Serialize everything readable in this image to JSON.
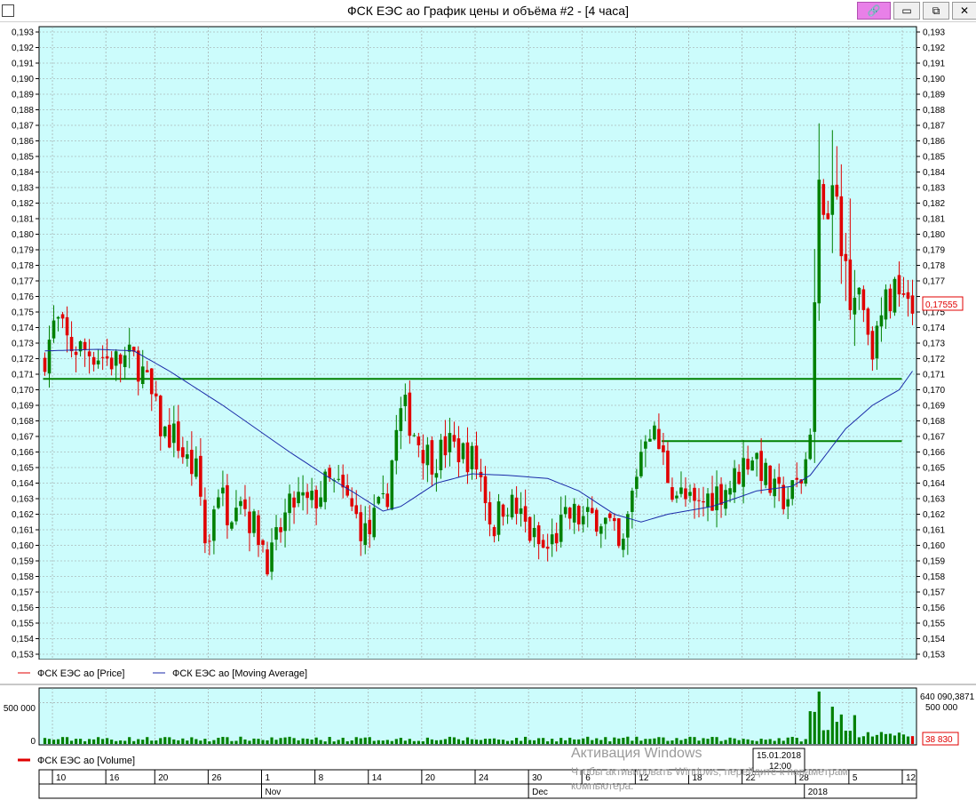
{
  "window": {
    "title": "ФСК ЕЭС ао График цены и объёма #2 - [4 часа]",
    "minimize_glyph": "▭",
    "restore_glyph": "⧉",
    "close_glyph": "✕",
    "link_icon": "link-icon"
  },
  "chart_data": {
    "type": "candlestick",
    "price_panel": {
      "ylim": [
        0.153,
        0.193
      ],
      "yticks": [
        "0,193",
        "0,192",
        "0,191",
        "0,190",
        "0,189",
        "0,188",
        "0,187",
        "0,186",
        "0,185",
        "0,184",
        "0,183",
        "0,182",
        "0,181",
        "0,180",
        "0,179",
        "0,178",
        "0,177",
        "0,176",
        "0,175",
        "0,174",
        "0,173",
        "0,172",
        "0,171",
        "0,170",
        "0,169",
        "0,168",
        "0,167",
        "0,166",
        "0,165",
        "0,164",
        "0,163",
        "0,162",
        "0,161",
        "0,160",
        "0,159",
        "0,158",
        "0,157",
        "0,156",
        "0,155",
        "0,154",
        "0,153"
      ],
      "last_price_label": "0,17555",
      "last_price": 0.17555,
      "up_color": "#008000",
      "down_color": "#e00000",
      "ma_color": "#1a2aa8",
      "line_color": "#008000",
      "background": "#ccfcfc",
      "horizontal_lines": [
        {
          "value": 0.1707,
          "from_bar": 0,
          "to_bar": 191
        },
        {
          "value": 0.1667,
          "from_bar": 139,
          "to_bar": 191
        }
      ],
      "legend": [
        {
          "label": "ФСК ЕЭС ао [Price]",
          "color": "#e00000"
        },
        {
          "label": "ФСК ЕЭС ао [Moving Average]",
          "color": "#1a2aa8"
        }
      ],
      "ohlc_anchors": [
        [
          0,
          0.1718
        ],
        [
          3,
          0.1745
        ],
        [
          6,
          0.1728
        ],
        [
          10,
          0.1725
        ],
        [
          13,
          0.1722
        ],
        [
          16,
          0.1718
        ],
        [
          20,
          0.172
        ],
        [
          22,
          0.1715
        ],
        [
          25,
          0.169
        ],
        [
          27,
          0.1672
        ],
        [
          30,
          0.167
        ],
        [
          32,
          0.1655
        ],
        [
          35,
          0.1645
        ],
        [
          36,
          0.1615
        ],
        [
          37,
          0.159
        ],
        [
          39,
          0.164
        ],
        [
          42,
          0.162
        ],
        [
          44,
          0.164
        ],
        [
          46,
          0.162
        ],
        [
          49,
          0.1605
        ],
        [
          51,
          0.1588
        ],
        [
          54,
          0.1615
        ],
        [
          57,
          0.163
        ],
        [
          60,
          0.1625
        ],
        [
          64,
          0.164
        ],
        [
          67,
          0.1635
        ],
        [
          70,
          0.162
        ],
        [
          73,
          0.1605
        ],
        [
          75,
          0.162
        ],
        [
          77,
          0.1625
        ],
        [
          79,
          0.1665
        ],
        [
          81,
          0.169
        ],
        [
          84,
          0.167
        ],
        [
          86,
          0.166
        ],
        [
          88,
          0.1655
        ],
        [
          91,
          0.1665
        ],
        [
          94,
          0.166
        ],
        [
          97,
          0.1655
        ],
        [
          99,
          0.164
        ],
        [
          101,
          0.161
        ],
        [
          104,
          0.163
        ],
        [
          107,
          0.162
        ],
        [
          110,
          0.1605
        ],
        [
          113,
          0.1595
        ],
        [
          116,
          0.161
        ],
        [
          119,
          0.162
        ],
        [
          122,
          0.1615
        ],
        [
          125,
          0.162
        ],
        [
          128,
          0.161
        ],
        [
          130,
          0.159
        ],
        [
          132,
          0.1625
        ],
        [
          134,
          0.1655
        ],
        [
          136,
          0.168
        ],
        [
          139,
          0.166
        ],
        [
          141,
          0.164
        ],
        [
          144,
          0.163
        ],
        [
          147,
          0.1622
        ],
        [
          149,
          0.163
        ],
        [
          152,
          0.1635
        ],
        [
          155,
          0.164
        ],
        [
          158,
          0.1655
        ],
        [
          160,
          0.166
        ],
        [
          163,
          0.164
        ],
        [
          165,
          0.163
        ],
        [
          168,
          0.1632
        ],
        [
          171,
          0.1645
        ],
        [
          172,
          0.1665
        ],
        [
          173,
          0.1715
        ],
        [
          174,
          0.179
        ],
        [
          175,
          0.184
        ],
        [
          176,
          0.18
        ],
        [
          177,
          0.181
        ],
        [
          178,
          0.183
        ],
        [
          179,
          0.179
        ],
        [
          181,
          0.178
        ],
        [
          183,
          0.1775
        ],
        [
          185,
          0.1745
        ],
        [
          187,
          0.1725
        ],
        [
          189,
          0.1755
        ],
        [
          191,
          0.176
        ],
        [
          193,
          0.1775
        ],
        [
          195,
          0.1757
        ]
      ],
      "moving_average_anchors": [
        [
          0,
          0.1725
        ],
        [
          12,
          0.1726
        ],
        [
          20,
          0.1725
        ],
        [
          28,
          0.1712
        ],
        [
          40,
          0.169
        ],
        [
          55,
          0.166
        ],
        [
          63,
          0.1645
        ],
        [
          70,
          0.1633
        ],
        [
          76,
          0.1622
        ],
        [
          80,
          0.1625
        ],
        [
          88,
          0.164
        ],
        [
          96,
          0.1646
        ],
        [
          104,
          0.1645
        ],
        [
          113,
          0.1643
        ],
        [
          120,
          0.1635
        ],
        [
          128,
          0.162
        ],
        [
          134,
          0.1615
        ],
        [
          140,
          0.162
        ],
        [
          150,
          0.1625
        ],
        [
          160,
          0.1635
        ],
        [
          168,
          0.1638
        ],
        [
          172,
          0.1645
        ],
        [
          176,
          0.166
        ],
        [
          180,
          0.1675
        ],
        [
          186,
          0.169
        ],
        [
          192,
          0.17
        ],
        [
          195,
          0.1712
        ]
      ]
    },
    "volume_panel": {
      "ytick": "500 000",
      "ytick_value": 500000,
      "ytick_zero": "0",
      "right_top_label": "640 090,3871",
      "right_mid_label": "500 000",
      "last_volume_label": "38 830",
      "last_volume": 38830,
      "ymax": 640090,
      "bar_color": "#008000",
      "down_bar_color": "#e00000",
      "legend": {
        "label": "ФСК ЕЭС ао [Volume]",
        "color": "#e00000"
      }
    },
    "x_axis": {
      "bars": 196,
      "day_ticks": [
        {
          "label": "10",
          "bar": 3
        },
        {
          "label": "16",
          "bar": 15
        },
        {
          "label": "20",
          "bar": 26
        },
        {
          "label": "26",
          "bar": 38
        },
        {
          "label": "1",
          "bar": 50
        },
        {
          "label": "8",
          "bar": 62
        },
        {
          "label": "14",
          "bar": 74
        },
        {
          "label": "20",
          "bar": 86
        },
        {
          "label": "24",
          "bar": 98
        },
        {
          "label": "30",
          "bar": 110
        },
        {
          "label": "6",
          "bar": 122
        },
        {
          "label": "12",
          "bar": 134
        },
        {
          "label": "18",
          "bar": 146
        },
        {
          "label": "22",
          "bar": 158
        },
        {
          "label": "28",
          "bar": 170
        },
        {
          "label": "5",
          "bar": 182
        },
        {
          "label": "12",
          "bar": 194
        }
      ],
      "month_ticks": [
        {
          "label": "Nov",
          "bar": 50
        },
        {
          "label": "Dec",
          "bar": 110
        },
        {
          "label": "2018",
          "bar": 172
        }
      ],
      "cursor_label_date": "15.01.2018",
      "cursor_label_time": "12:00"
    }
  },
  "watermark": {
    "line1": "Активация Windows",
    "line2": "Чтобы активировать Windows, перейдите к параметрам",
    "line3": "компьютера."
  }
}
